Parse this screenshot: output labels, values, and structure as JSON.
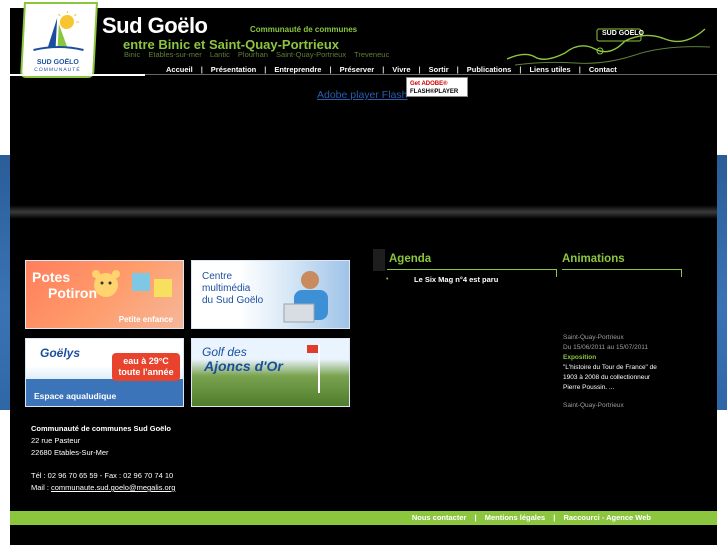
{
  "header": {
    "title": "Sud Goëlo",
    "tagline": "Communauté de communes",
    "subtitle": "entre Binic et Saint-Quay-Portrieux",
    "towns": [
      "Binic",
      "Etables-sur-mer",
      "Lantic",
      "Plourhan",
      "Saint-Quay-Portrieux",
      "Treveneuc"
    ],
    "logo_text": "SUD GOËLO",
    "logo_sub": "COMMUNAUTÉ",
    "map_label": "SUD GOËLO"
  },
  "nav": {
    "items": [
      "Accueil",
      "Présentation",
      "Entreprendre",
      "Préserver",
      "Vivre",
      "Sortir",
      "Publications",
      "Liens utiles",
      "Contact"
    ]
  },
  "flash": {
    "link_text": "Adobe player Flash",
    "badge_line1": "Get ADOBE®",
    "badge_line2": "FLASH®PLAYER"
  },
  "tiles": {
    "potes": {
      "line1": "Potes",
      "line2": "Potiron",
      "sub": "Petite enfance"
    },
    "centre": {
      "line1": "Centre",
      "line2": "multimédia",
      "line3": "du Sud Goëlo"
    },
    "goelys": {
      "brand": "Goëlys",
      "badge_line1": "eau à 29°C",
      "badge_line2": "toute l'année",
      "sub": "Espace aqualudique"
    },
    "golf": {
      "line1": "Golf des",
      "line2": "Ajoncs d'Or"
    }
  },
  "agenda": {
    "title": "Agenda",
    "items": [
      "Le Six Mag n°4 est paru"
    ]
  },
  "animations": {
    "title": "Animations",
    "location": "Saint-Quay-Portrieux",
    "dates": "Du 15/06/2011 au 15/07/2011",
    "category": "Exposition",
    "description": [
      "\"L'histoire du Tour de France\" de",
      "1903 à 2008  du collectionneur",
      "Pierre Poussin. ..."
    ],
    "next_location": "Saint-Quay-Portrieux"
  },
  "footer": {
    "org": "Communauté de communes Sud Goëlo",
    "street": "22 rue Pasteur",
    "city": "22680 Etables-Sur-Mer",
    "phone": "Tél : 02 96 70 65 59 - Fax : 02 96 70 74 10",
    "mail_label": "Mail : ",
    "mail": "communaute.sud.goelo@megalis.org",
    "links": [
      "Nous contacter",
      "Mentions légales",
      "Raccourci - Agence Web"
    ]
  },
  "colors": {
    "accent_green": "#8cc63f",
    "brand_blue": "#1b4f9c",
    "background_black": "#000000"
  }
}
